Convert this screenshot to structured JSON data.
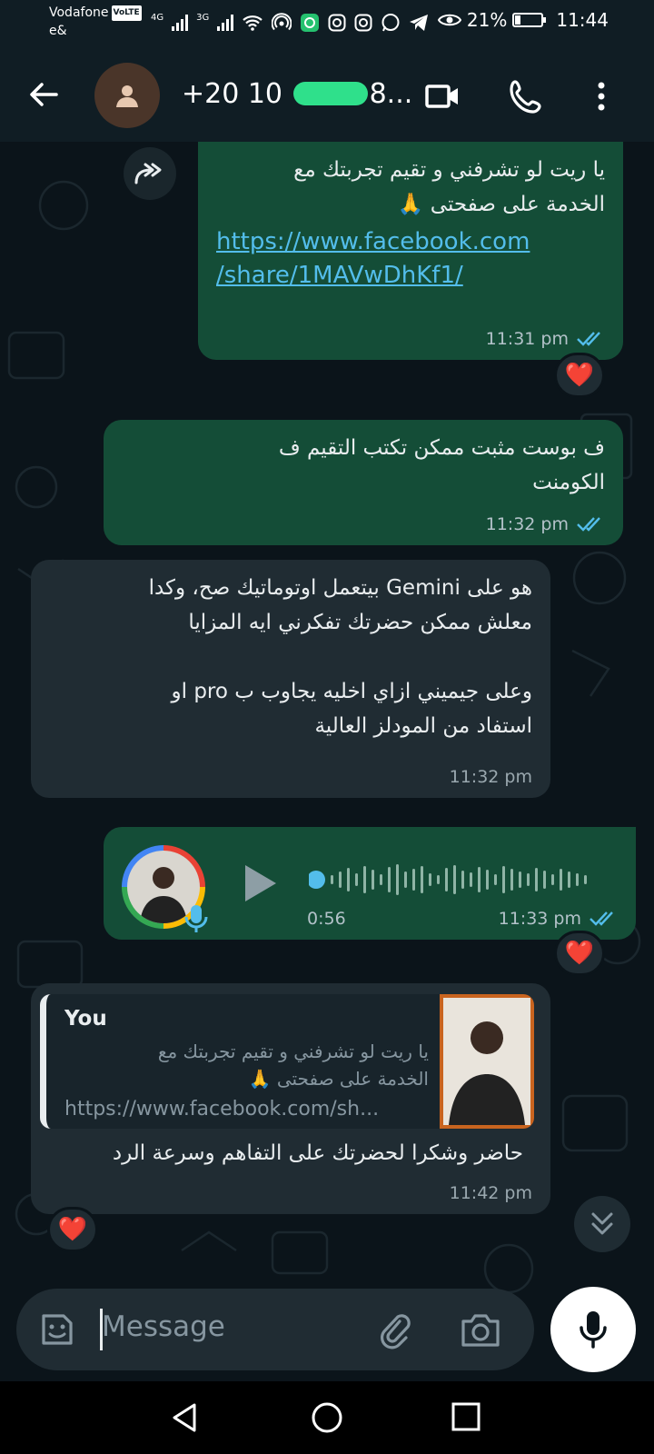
{
  "status_bar": {
    "carrier": "Vodafone",
    "carrier_badge": "VoLTE",
    "carrier_line2": "e&",
    "network_1": "4G",
    "network_2": "3G",
    "battery_percent": "21%",
    "battery_level": 0.21,
    "time": "11:44",
    "icons": [
      "signal-icon",
      "wifi-icon",
      "hotspot-icon",
      "app-icon",
      "instagram-icon",
      "instagram-icon",
      "whatsapp-icon",
      "telegram-icon",
      "eye-icon"
    ]
  },
  "header": {
    "contact_prefix": "+20 10",
    "contact_suffix": "8...",
    "icons": [
      "back-arrow-icon",
      "avatar-icon",
      "video-call-icon",
      "phone-call-icon",
      "more-vert-icon"
    ]
  },
  "messages": [
    {
      "id": "m1",
      "direction": "out",
      "text": "يا ريت لو تشرفني و تقيم تجربتك مع\nالخدمة على صفحتى 🙏",
      "link": "https://www.facebook.com/share/1MAVwDhKf1/",
      "link_line1": "https://www.facebook.com",
      "link_line2": "/share/1MAVwDhKf1/",
      "time": "11:31 pm",
      "status": "read",
      "reaction": "❤️"
    },
    {
      "id": "m2",
      "direction": "out",
      "text": "ف بوست مثبت ممكن تكتب التقيم ف\nالكومنت",
      "time": "11:32 pm",
      "status": "read"
    },
    {
      "id": "m3",
      "direction": "in",
      "text": "هو على Gemini بيتعمل اوتوماتيك صح، وكدا\nمعلش ممكن حضرتك تفكرني ايه المزايا\n\nوعلى جيميني ازاي اخليه يجاوب ب pro او\nاستفاد من المودلز العالية",
      "time": "11:32 pm"
    },
    {
      "id": "m4",
      "direction": "out",
      "type": "voice",
      "duration": "0:56",
      "time": "11:33 pm",
      "status": "read",
      "reaction": "❤️"
    },
    {
      "id": "m5",
      "direction": "in",
      "quote_author": "You",
      "quote_text": "يا ريت لو تشرفني و تقيم تجربتك مع\nالخدمة على صفحتى 🙏",
      "quote_link": "https://www.facebook.com/sh...",
      "text": "حاضر وشكرا لحضرتك على التفاهم وسرعة الرد",
      "time": "11:42 pm",
      "reaction": "❤️"
    }
  ],
  "composer": {
    "placeholder": "Message"
  },
  "colors": {
    "background": "#0b141a",
    "outgoing_bubble": "#144d37",
    "incoming_bubble": "#202c33",
    "link": "#53bdeb",
    "read_ticks": "#53bdeb",
    "header": "#101d24"
  }
}
